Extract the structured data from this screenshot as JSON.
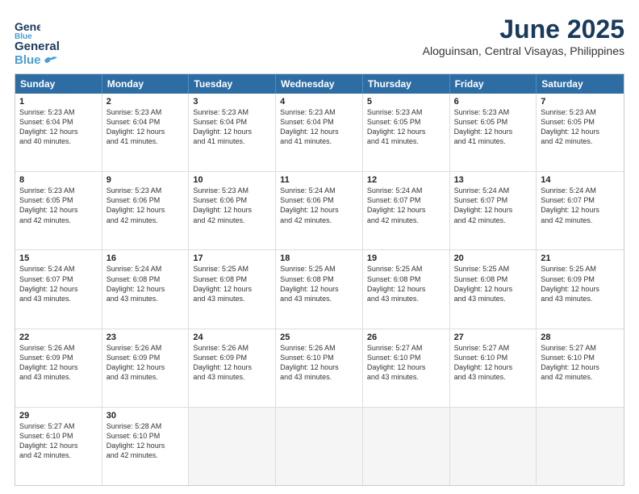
{
  "header": {
    "logo_general": "General",
    "logo_blue": "Blue",
    "title": "June 2025",
    "subtitle": "Aloguinsan, Central Visayas, Philippines"
  },
  "days_of_week": [
    "Sunday",
    "Monday",
    "Tuesday",
    "Wednesday",
    "Thursday",
    "Friday",
    "Saturday"
  ],
  "weeks": [
    [
      {
        "day": "1",
        "lines": [
          "Sunrise: 5:23 AM",
          "Sunset: 6:04 PM",
          "Daylight: 12 hours",
          "and 40 minutes."
        ]
      },
      {
        "day": "2",
        "lines": [
          "Sunrise: 5:23 AM",
          "Sunset: 6:04 PM",
          "Daylight: 12 hours",
          "and 41 minutes."
        ]
      },
      {
        "day": "3",
        "lines": [
          "Sunrise: 5:23 AM",
          "Sunset: 6:04 PM",
          "Daylight: 12 hours",
          "and 41 minutes."
        ]
      },
      {
        "day": "4",
        "lines": [
          "Sunrise: 5:23 AM",
          "Sunset: 6:04 PM",
          "Daylight: 12 hours",
          "and 41 minutes."
        ]
      },
      {
        "day": "5",
        "lines": [
          "Sunrise: 5:23 AM",
          "Sunset: 6:05 PM",
          "Daylight: 12 hours",
          "and 41 minutes."
        ]
      },
      {
        "day": "6",
        "lines": [
          "Sunrise: 5:23 AM",
          "Sunset: 6:05 PM",
          "Daylight: 12 hours",
          "and 41 minutes."
        ]
      },
      {
        "day": "7",
        "lines": [
          "Sunrise: 5:23 AM",
          "Sunset: 6:05 PM",
          "Daylight: 12 hours",
          "and 42 minutes."
        ]
      }
    ],
    [
      {
        "day": "8",
        "lines": [
          "Sunrise: 5:23 AM",
          "Sunset: 6:05 PM",
          "Daylight: 12 hours",
          "and 42 minutes."
        ]
      },
      {
        "day": "9",
        "lines": [
          "Sunrise: 5:23 AM",
          "Sunset: 6:06 PM",
          "Daylight: 12 hours",
          "and 42 minutes."
        ]
      },
      {
        "day": "10",
        "lines": [
          "Sunrise: 5:23 AM",
          "Sunset: 6:06 PM",
          "Daylight: 12 hours",
          "and 42 minutes."
        ]
      },
      {
        "day": "11",
        "lines": [
          "Sunrise: 5:24 AM",
          "Sunset: 6:06 PM",
          "Daylight: 12 hours",
          "and 42 minutes."
        ]
      },
      {
        "day": "12",
        "lines": [
          "Sunrise: 5:24 AM",
          "Sunset: 6:07 PM",
          "Daylight: 12 hours",
          "and 42 minutes."
        ]
      },
      {
        "day": "13",
        "lines": [
          "Sunrise: 5:24 AM",
          "Sunset: 6:07 PM",
          "Daylight: 12 hours",
          "and 42 minutes."
        ]
      },
      {
        "day": "14",
        "lines": [
          "Sunrise: 5:24 AM",
          "Sunset: 6:07 PM",
          "Daylight: 12 hours",
          "and 42 minutes."
        ]
      }
    ],
    [
      {
        "day": "15",
        "lines": [
          "Sunrise: 5:24 AM",
          "Sunset: 6:07 PM",
          "Daylight: 12 hours",
          "and 43 minutes."
        ]
      },
      {
        "day": "16",
        "lines": [
          "Sunrise: 5:24 AM",
          "Sunset: 6:08 PM",
          "Daylight: 12 hours",
          "and 43 minutes."
        ]
      },
      {
        "day": "17",
        "lines": [
          "Sunrise: 5:25 AM",
          "Sunset: 6:08 PM",
          "Daylight: 12 hours",
          "and 43 minutes."
        ]
      },
      {
        "day": "18",
        "lines": [
          "Sunrise: 5:25 AM",
          "Sunset: 6:08 PM",
          "Daylight: 12 hours",
          "and 43 minutes."
        ]
      },
      {
        "day": "19",
        "lines": [
          "Sunrise: 5:25 AM",
          "Sunset: 6:08 PM",
          "Daylight: 12 hours",
          "and 43 minutes."
        ]
      },
      {
        "day": "20",
        "lines": [
          "Sunrise: 5:25 AM",
          "Sunset: 6:08 PM",
          "Daylight: 12 hours",
          "and 43 minutes."
        ]
      },
      {
        "day": "21",
        "lines": [
          "Sunrise: 5:25 AM",
          "Sunset: 6:09 PM",
          "Daylight: 12 hours",
          "and 43 minutes."
        ]
      }
    ],
    [
      {
        "day": "22",
        "lines": [
          "Sunrise: 5:26 AM",
          "Sunset: 6:09 PM",
          "Daylight: 12 hours",
          "and 43 minutes."
        ]
      },
      {
        "day": "23",
        "lines": [
          "Sunrise: 5:26 AM",
          "Sunset: 6:09 PM",
          "Daylight: 12 hours",
          "and 43 minutes."
        ]
      },
      {
        "day": "24",
        "lines": [
          "Sunrise: 5:26 AM",
          "Sunset: 6:09 PM",
          "Daylight: 12 hours",
          "and 43 minutes."
        ]
      },
      {
        "day": "25",
        "lines": [
          "Sunrise: 5:26 AM",
          "Sunset: 6:10 PM",
          "Daylight: 12 hours",
          "and 43 minutes."
        ]
      },
      {
        "day": "26",
        "lines": [
          "Sunrise: 5:27 AM",
          "Sunset: 6:10 PM",
          "Daylight: 12 hours",
          "and 43 minutes."
        ]
      },
      {
        "day": "27",
        "lines": [
          "Sunrise: 5:27 AM",
          "Sunset: 6:10 PM",
          "Daylight: 12 hours",
          "and 43 minutes."
        ]
      },
      {
        "day": "28",
        "lines": [
          "Sunrise: 5:27 AM",
          "Sunset: 6:10 PM",
          "Daylight: 12 hours",
          "and 42 minutes."
        ]
      }
    ],
    [
      {
        "day": "29",
        "lines": [
          "Sunrise: 5:27 AM",
          "Sunset: 6:10 PM",
          "Daylight: 12 hours",
          "and 42 minutes."
        ]
      },
      {
        "day": "30",
        "lines": [
          "Sunrise: 5:28 AM",
          "Sunset: 6:10 PM",
          "Daylight: 12 hours",
          "and 42 minutes."
        ]
      },
      {
        "day": "",
        "lines": []
      },
      {
        "day": "",
        "lines": []
      },
      {
        "day": "",
        "lines": []
      },
      {
        "day": "",
        "lines": []
      },
      {
        "day": "",
        "lines": []
      }
    ]
  ]
}
